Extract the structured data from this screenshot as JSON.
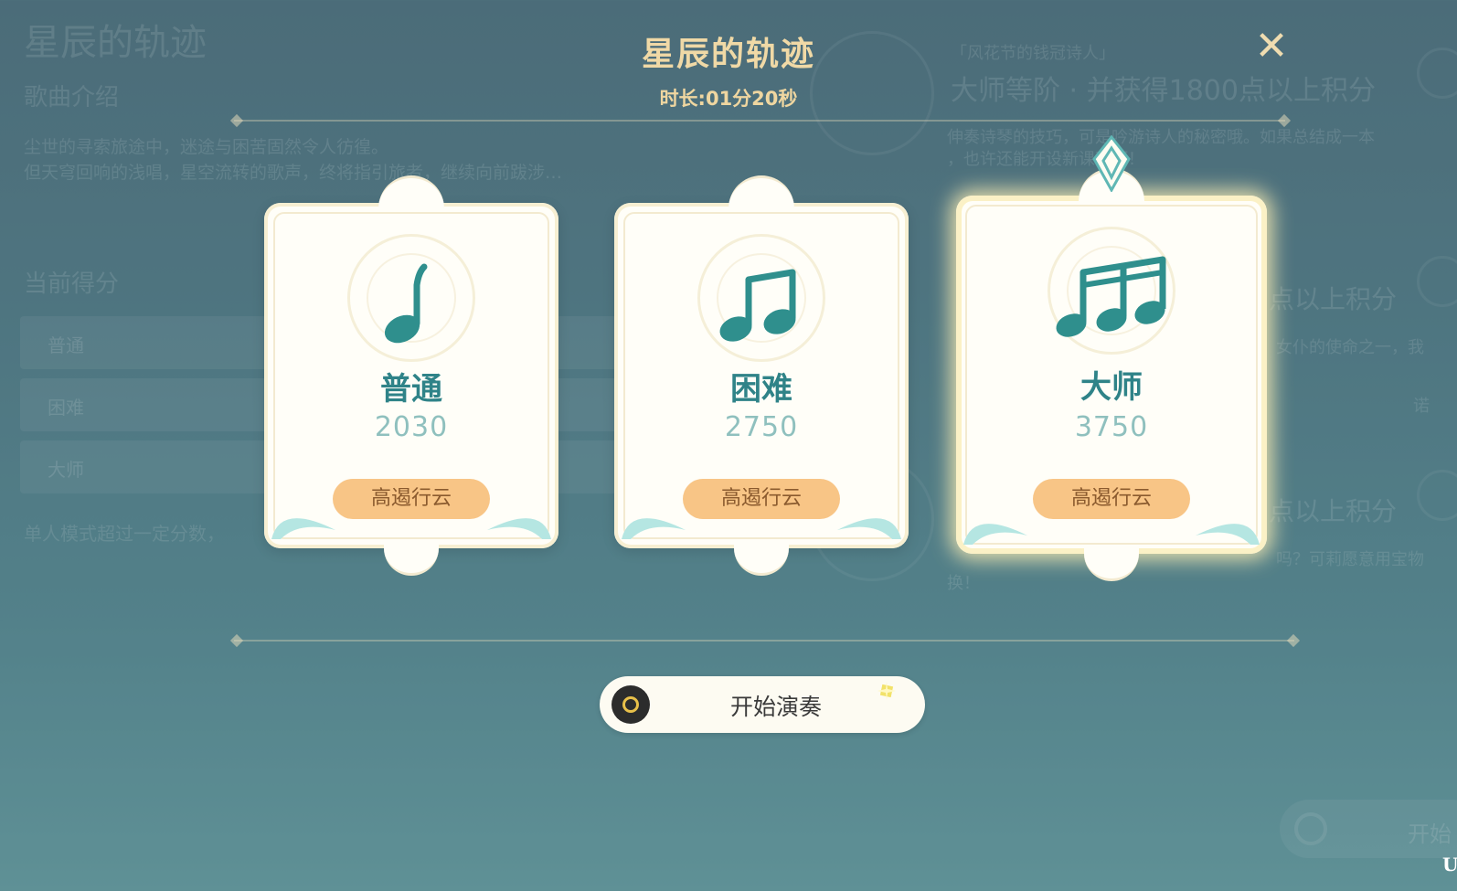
{
  "background": {
    "song_title": "星辰的轨迹",
    "song_intro_header": "歌曲介绍",
    "song_intro_lines": [
      "尘世的寻索旅途中，迷途与困苦固然令人彷徨。",
      "但天穹回响的浅唱，星空流转的歌声，终将指引旅者，继续向前跋涉…"
    ],
    "current_score_header": "当前得分",
    "score_rows": [
      "普通",
      "困难",
      "大师"
    ],
    "single_mode_note": "单人模式超过一定分数，",
    "quest_tag": "「风花节的钱冠诗人」",
    "quest_title": "大师等阶 · 并获得1800点以上积分",
    "quest_desc_lines": [
      "伸奏诗琴的技巧，可是吟游诗人的秘密哦。如果总结成一本",
      "，也许还能开设新课程啊！"
    ],
    "right_line_1": "点以上积分",
    "right_line_2": "女仆的使命之一，我",
    "right_line_3": "诺",
    "right_line_4": "点以上积分",
    "right_line_5": "吗？可莉愿意用宝物",
    "right_line_6": "换！",
    "bg_start_label": "开始"
  },
  "header": {
    "title": "星辰的轨迹",
    "duration": "时长:01分20秒"
  },
  "cards": [
    {
      "mode": "普通",
      "score": "2030",
      "badge": "高遏行云",
      "note_icon": "single-note-icon"
    },
    {
      "mode": "困难",
      "score": "2750",
      "badge": "高遏行云",
      "note_icon": "beamed-two-notes-icon"
    },
    {
      "mode": "大师",
      "score": "3750",
      "badge": "高遏行云",
      "note_icon": "beamed-three-notes-icon"
    }
  ],
  "selected_card": "大师",
  "start_button": {
    "label": "开始演奏",
    "key_icon": "controller-button-icon"
  },
  "corner_glyph": "U",
  "colors": {
    "accent_teal": "#2f8388",
    "badge_orange": "#f8c586",
    "title_gold": "#f0d9a6"
  }
}
